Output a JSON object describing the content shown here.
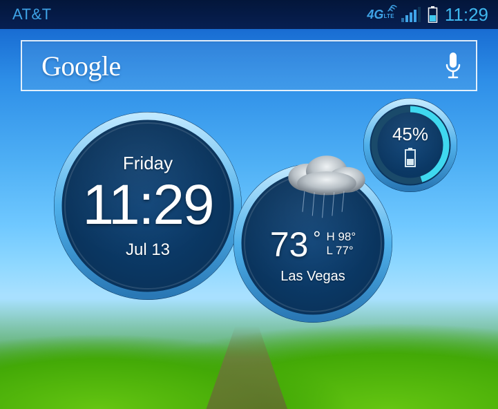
{
  "status": {
    "carrier": "AT&T",
    "network": "4G",
    "network_sub": "LTE",
    "time": "11:29"
  },
  "search": {
    "provider": "Google"
  },
  "clock": {
    "day": "Friday",
    "time": "11:29",
    "date": "Jul 13"
  },
  "weather": {
    "temp": "73",
    "high": "H 98°",
    "low": "L 77°",
    "city": "Las Vegas"
  },
  "battery": {
    "percent": "45%"
  }
}
